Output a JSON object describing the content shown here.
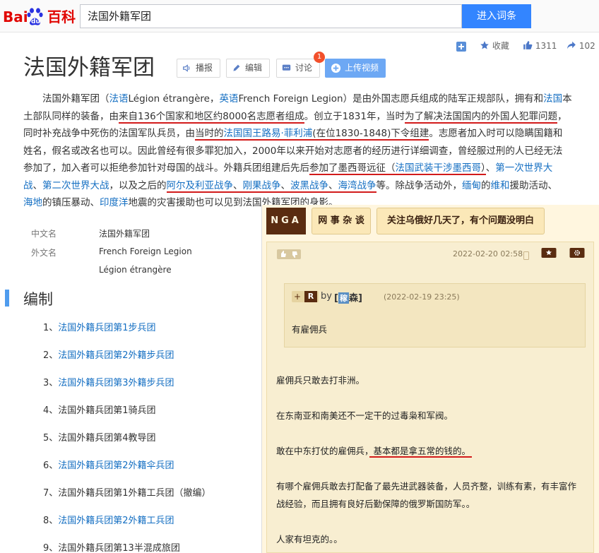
{
  "header": {
    "logo_text": "百科",
    "search_value": "法国外籍军团",
    "search_button": "进入词条"
  },
  "stats": {
    "collect_label": "收藏",
    "like_count": "1311",
    "share_count": "102"
  },
  "title": "法国外籍军团",
  "toolbar": {
    "play_label": "播报",
    "edit_label": "编辑",
    "discuss_label": "讨论",
    "discuss_badge": "1",
    "upload_label": "上传视频"
  },
  "intro": {
    "l1a": "法国外籍军团（",
    "l1b": "法语",
    "l1c": "Légion étrangère，",
    "l1d": "英语",
    "l1e": "French Foreign Legion）是由外国志愿兵组成的陆军正规部队，拥有和",
    "l1f": "法国",
    "l1g": "本",
    "l2a": "土部队同样的装备，由",
    "l2b": "来自136个国家和地区约8000名志愿者组成",
    "l2c": "。创立于1831年，当时",
    "l2d": "为了解决法国国内的外国人犯罪问题",
    "l2e": "，",
    "l3a": "同时补充战争中死伤的法国军队兵员，由",
    "l3b": "当时的",
    "l3c": "法国国王路易·菲利浦",
    "l3d": "(在位1830-1848)下令组建",
    "l3e": "。志愿者加入时可以隐瞒国籍和",
    "l4": "姓名，假名或改名也可以。因此曾经有很多罪犯加入，2000年以来开始对志愿者的经历进行详细调查，曾经服过刑的人已经无法",
    "l5a": "参加了，加入者可以拒绝参加针对母国的战斗。外籍兵团组建后先后",
    "l5b": "参加了墨西哥远征（",
    "l5c": "法国武装干涉墨西哥",
    "l5d": "）",
    "l5e": "、",
    "l5f": "第一次世界大",
    "l6a": "战",
    "l6b": "、",
    "l6c": "第二次世界大战",
    "l6d": "，以及之后的",
    "l6e": "阿尔及利亚战争",
    "l6f": "、",
    "l6g": "刚果战争",
    "l6h": "、",
    "l6i": "波黑战争",
    "l6j": "、",
    "l6k": "海湾战争",
    "l6l": "等。除战争活动外，",
    "l6m": "缅甸",
    "l6n": "的",
    "l6o": "维和",
    "l6p": "援助活动、",
    "l7a": "海地",
    "l7b": "的镇压暴动、",
    "l7c": "印度洋",
    "l7d": "地震的灾害援助也可以见到法国外籍军团的身影。"
  },
  "infobox": [
    {
      "key": "中文名",
      "value": "法国外籍军团"
    },
    {
      "key": "外文名",
      "value": "French Foreign Legion"
    },
    {
      "key": "",
      "value": "Légion étrangère"
    }
  ],
  "section_title": "编制",
  "units": [
    {
      "num": "1、",
      "name": "法国外籍兵团第1步兵团",
      "link": true
    },
    {
      "num": "2、",
      "name": "法国外籍兵团第2外籍步兵团",
      "link": true
    },
    {
      "num": "3、",
      "name": "法国外籍兵团第3外籍步兵团",
      "link": true
    },
    {
      "num": "4、",
      "name": "法国外籍兵团第1骑兵团",
      "link": false
    },
    {
      "num": "5、",
      "name": "法国外籍兵团第4教导团",
      "link": false
    },
    {
      "num": "6、",
      "name": "法国外籍兵团第2外籍伞兵团",
      "link": true
    },
    {
      "num": "7、",
      "name": "法国外籍兵团第1外籍工兵团（撤编）",
      "link": false
    },
    {
      "num": "8、",
      "name": "法国外籍兵团第2外籍工兵团",
      "link": true
    },
    {
      "num": "9、",
      "name": "法国外籍兵团第13半混成旅团",
      "link": false
    }
  ],
  "nga": {
    "logo": "NGA",
    "board": "网 事 杂 谈",
    "thread_title": "关注乌俄好几天了，有个问题没明白",
    "post_time": "2022-02-20 02:58",
    "quote_tag": "R",
    "quote_by": "by",
    "quote_user_badge": "稼",
    "quote_user": "森]",
    "quote_time": "(2022-02-19 23:25)",
    "quote_text": "有雇佣兵",
    "body": [
      "雇佣兵只敢去打非洲。",
      "在东南亚和南美还不一定干的过毒枭和军阀。",
      "敢在中东打仗的雇佣兵，基本都是拿五常的钱的。",
      "有哪个雇佣兵敢去打配备了最先进武器装备，人员齐整，训练有素，有丰富作",
      "战经验，而且拥有良好后勤保障的俄罗斯国防军。。",
      "人家有坦克的。。"
    ],
    "body_underlined": "基本都是拿五常的钱的。"
  }
}
